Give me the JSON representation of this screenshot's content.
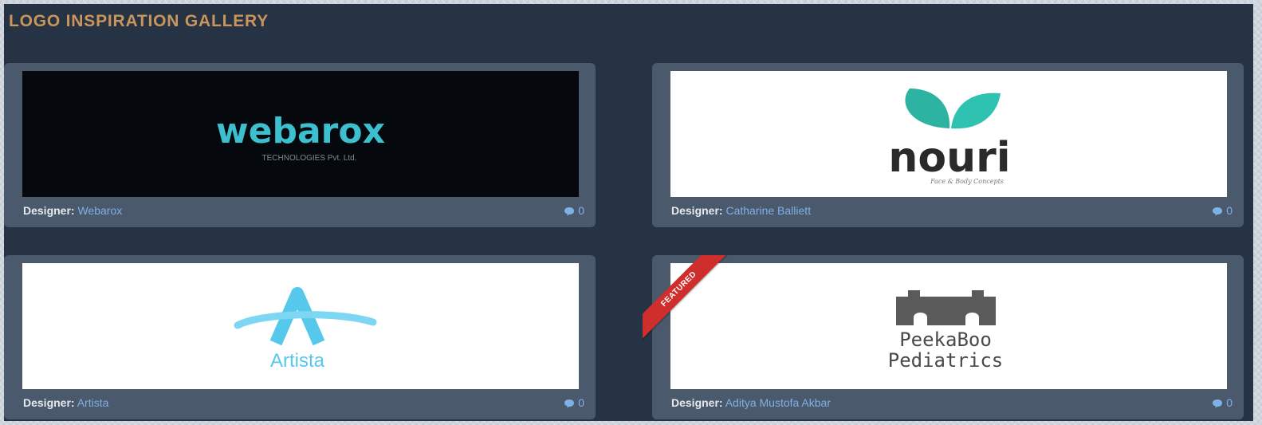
{
  "gallery": {
    "title": "LOGO INSPIRATION GALLERY",
    "cards": [
      {
        "designer_label": "Designer:",
        "designer_name": "Webarox",
        "comment_count": "0",
        "logo": {
          "main": "webarox",
          "sub": "TECHNOLOGIES Pvt. Ltd."
        },
        "featured": false
      },
      {
        "designer_label": "Designer:",
        "designer_name": "Catharine Balliett",
        "comment_count": "0",
        "logo": {
          "main": "nouri",
          "sub": "Face & Body Concepts"
        },
        "featured": false
      },
      {
        "designer_label": "Designer:",
        "designer_name": "Artista",
        "comment_count": "0",
        "logo": {
          "main": "Artista"
        },
        "featured": false
      },
      {
        "designer_label": "Designer:",
        "designer_name": "Aditya Mustofa Akbar",
        "comment_count": "0",
        "logo": {
          "main": "PeekaBoo",
          "sub": "Pediatrics"
        },
        "featured": true,
        "badge": "FEATURED"
      }
    ]
  },
  "colors": {
    "panel": "#253345",
    "title": "#c9955a",
    "card": "#4a596b",
    "link": "#7fb0e6",
    "ribbon": "#d02d2d"
  },
  "icons": {
    "comments": "speech-bubble-icon"
  }
}
